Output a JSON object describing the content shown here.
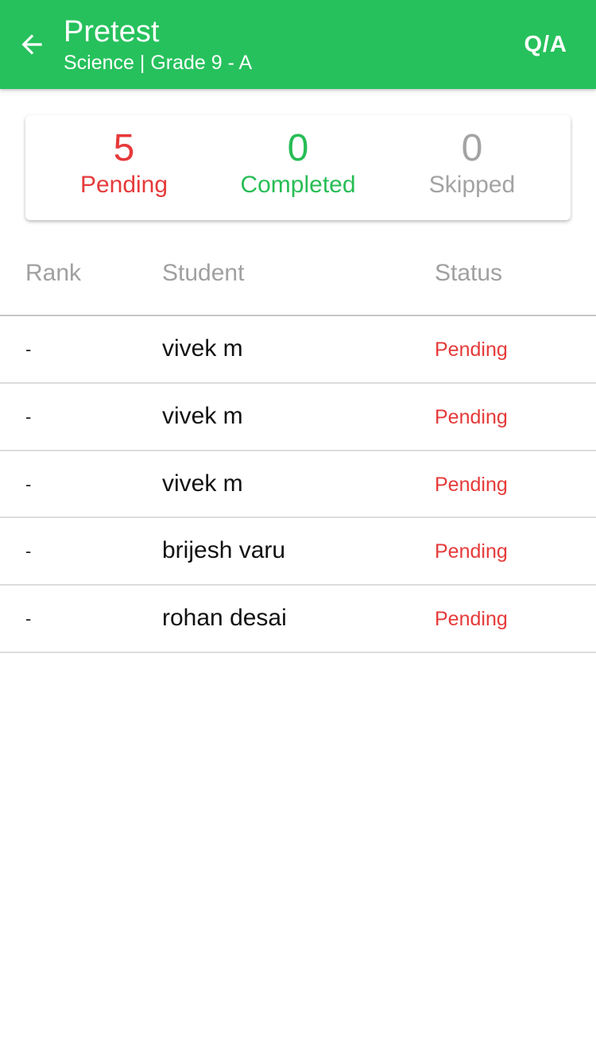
{
  "appbar": {
    "title": "Pretest",
    "subtitle": "Science | Grade 9 - A",
    "action_label": "Q/A",
    "background_color": "#26c15c",
    "back_icon": "arrow-left-icon"
  },
  "summary": {
    "pending": {
      "value": "5",
      "label": "Pending",
      "color": "#e63a3a"
    },
    "completed": {
      "value": "0",
      "label": "Completed",
      "color": "#27bd55"
    },
    "skipped": {
      "value": "0",
      "label": "Skipped",
      "color": "#a3a3a3"
    }
  },
  "table": {
    "headers": {
      "rank": "Rank",
      "student": "Student",
      "status": "Status"
    },
    "rows": [
      {
        "rank": "-",
        "student": "vivek m",
        "status": "Pending"
      },
      {
        "rank": "-",
        "student": "vivek m",
        "status": "Pending"
      },
      {
        "rank": "-",
        "student": "vivek m",
        "status": "Pending"
      },
      {
        "rank": "-",
        "student": "brijesh varu",
        "status": "Pending"
      },
      {
        "rank": "-",
        "student": "rohan desai",
        "status": "Pending"
      }
    ]
  }
}
